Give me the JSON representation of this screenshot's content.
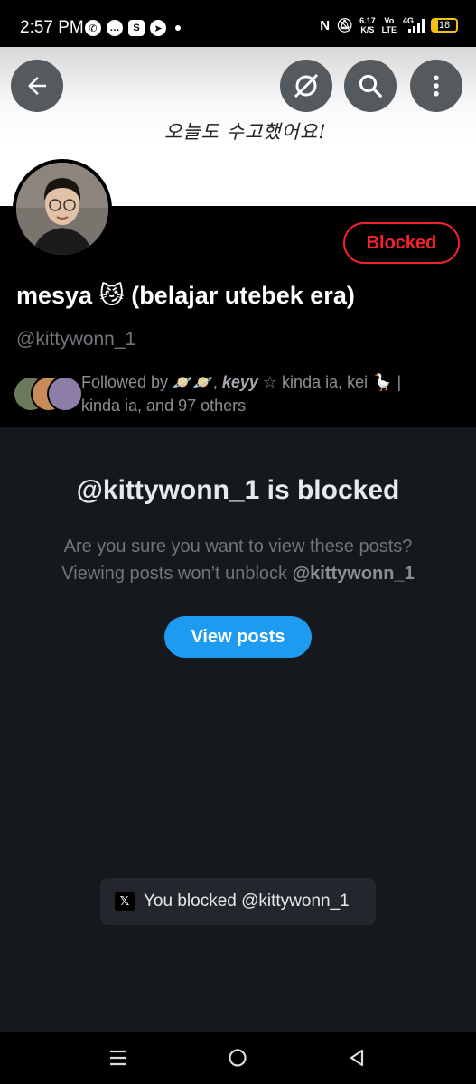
{
  "status_bar": {
    "time": "2:57 PM",
    "net_speed_value": "6.17",
    "net_speed_unit": "K/S",
    "network_vo": "Vo",
    "network_lte": "LTE",
    "network_type": "4G",
    "battery": "18",
    "app_icons": [
      "whatsapp-icon",
      "chat-icon",
      "shop-icon",
      "telegram-icon"
    ]
  },
  "banner": {
    "handwriting": "오늘도 수고했어요!"
  },
  "profile": {
    "blocked_label": "Blocked",
    "display_name": "mesya 😼 (belajar utebek era)",
    "handle": "@kittywonn_1",
    "followed_prefix": "Followed by 🪐🪐, ",
    "followed_bold": "keyy",
    "followed_rest": " ☆ kinda ia, kei 🪿 | kinda ia, and 97 others"
  },
  "blocked_notice": {
    "title": "@kittywonn_1 is blocked",
    "desc_line1": "Are you sure you want to view these posts?",
    "desc_line2": "Viewing posts won’t unblock ",
    "desc_handle": "@kittywonn_1",
    "view_button": "View posts"
  },
  "toast": {
    "logo": "𝕏",
    "message": "You blocked @kittywonn_1"
  },
  "colors": {
    "accent": "#1d9bf0",
    "blocked_red": "#f4212e",
    "background": "#15181c"
  }
}
